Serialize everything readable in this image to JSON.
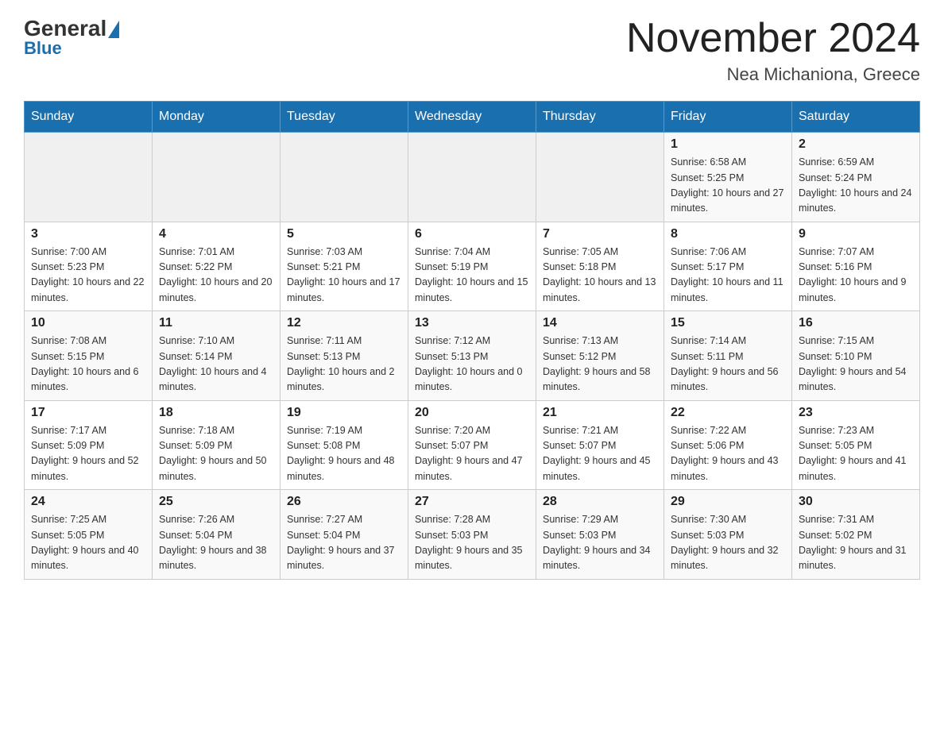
{
  "header": {
    "logo": {
      "general": "General",
      "blue": "Blue"
    },
    "title": "November 2024",
    "subtitle": "Nea Michaniona, Greece"
  },
  "weekdays": [
    "Sunday",
    "Monday",
    "Tuesday",
    "Wednesday",
    "Thursday",
    "Friday",
    "Saturday"
  ],
  "weeks": [
    {
      "days": [
        {
          "num": "",
          "info": ""
        },
        {
          "num": "",
          "info": ""
        },
        {
          "num": "",
          "info": ""
        },
        {
          "num": "",
          "info": ""
        },
        {
          "num": "",
          "info": ""
        },
        {
          "num": "1",
          "info": "Sunrise: 6:58 AM\nSunset: 5:25 PM\nDaylight: 10 hours and 27 minutes."
        },
        {
          "num": "2",
          "info": "Sunrise: 6:59 AM\nSunset: 5:24 PM\nDaylight: 10 hours and 24 minutes."
        }
      ]
    },
    {
      "days": [
        {
          "num": "3",
          "info": "Sunrise: 7:00 AM\nSunset: 5:23 PM\nDaylight: 10 hours and 22 minutes."
        },
        {
          "num": "4",
          "info": "Sunrise: 7:01 AM\nSunset: 5:22 PM\nDaylight: 10 hours and 20 minutes."
        },
        {
          "num": "5",
          "info": "Sunrise: 7:03 AM\nSunset: 5:21 PM\nDaylight: 10 hours and 17 minutes."
        },
        {
          "num": "6",
          "info": "Sunrise: 7:04 AM\nSunset: 5:19 PM\nDaylight: 10 hours and 15 minutes."
        },
        {
          "num": "7",
          "info": "Sunrise: 7:05 AM\nSunset: 5:18 PM\nDaylight: 10 hours and 13 minutes."
        },
        {
          "num": "8",
          "info": "Sunrise: 7:06 AM\nSunset: 5:17 PM\nDaylight: 10 hours and 11 minutes."
        },
        {
          "num": "9",
          "info": "Sunrise: 7:07 AM\nSunset: 5:16 PM\nDaylight: 10 hours and 9 minutes."
        }
      ]
    },
    {
      "days": [
        {
          "num": "10",
          "info": "Sunrise: 7:08 AM\nSunset: 5:15 PM\nDaylight: 10 hours and 6 minutes."
        },
        {
          "num": "11",
          "info": "Sunrise: 7:10 AM\nSunset: 5:14 PM\nDaylight: 10 hours and 4 minutes."
        },
        {
          "num": "12",
          "info": "Sunrise: 7:11 AM\nSunset: 5:13 PM\nDaylight: 10 hours and 2 minutes."
        },
        {
          "num": "13",
          "info": "Sunrise: 7:12 AM\nSunset: 5:13 PM\nDaylight: 10 hours and 0 minutes."
        },
        {
          "num": "14",
          "info": "Sunrise: 7:13 AM\nSunset: 5:12 PM\nDaylight: 9 hours and 58 minutes."
        },
        {
          "num": "15",
          "info": "Sunrise: 7:14 AM\nSunset: 5:11 PM\nDaylight: 9 hours and 56 minutes."
        },
        {
          "num": "16",
          "info": "Sunrise: 7:15 AM\nSunset: 5:10 PM\nDaylight: 9 hours and 54 minutes."
        }
      ]
    },
    {
      "days": [
        {
          "num": "17",
          "info": "Sunrise: 7:17 AM\nSunset: 5:09 PM\nDaylight: 9 hours and 52 minutes."
        },
        {
          "num": "18",
          "info": "Sunrise: 7:18 AM\nSunset: 5:09 PM\nDaylight: 9 hours and 50 minutes."
        },
        {
          "num": "19",
          "info": "Sunrise: 7:19 AM\nSunset: 5:08 PM\nDaylight: 9 hours and 48 minutes."
        },
        {
          "num": "20",
          "info": "Sunrise: 7:20 AM\nSunset: 5:07 PM\nDaylight: 9 hours and 47 minutes."
        },
        {
          "num": "21",
          "info": "Sunrise: 7:21 AM\nSunset: 5:07 PM\nDaylight: 9 hours and 45 minutes."
        },
        {
          "num": "22",
          "info": "Sunrise: 7:22 AM\nSunset: 5:06 PM\nDaylight: 9 hours and 43 minutes."
        },
        {
          "num": "23",
          "info": "Sunrise: 7:23 AM\nSunset: 5:05 PM\nDaylight: 9 hours and 41 minutes."
        }
      ]
    },
    {
      "days": [
        {
          "num": "24",
          "info": "Sunrise: 7:25 AM\nSunset: 5:05 PM\nDaylight: 9 hours and 40 minutes."
        },
        {
          "num": "25",
          "info": "Sunrise: 7:26 AM\nSunset: 5:04 PM\nDaylight: 9 hours and 38 minutes."
        },
        {
          "num": "26",
          "info": "Sunrise: 7:27 AM\nSunset: 5:04 PM\nDaylight: 9 hours and 37 minutes."
        },
        {
          "num": "27",
          "info": "Sunrise: 7:28 AM\nSunset: 5:03 PM\nDaylight: 9 hours and 35 minutes."
        },
        {
          "num": "28",
          "info": "Sunrise: 7:29 AM\nSunset: 5:03 PM\nDaylight: 9 hours and 34 minutes."
        },
        {
          "num": "29",
          "info": "Sunrise: 7:30 AM\nSunset: 5:03 PM\nDaylight: 9 hours and 32 minutes."
        },
        {
          "num": "30",
          "info": "Sunrise: 7:31 AM\nSunset: 5:02 PM\nDaylight: 9 hours and 31 minutes."
        }
      ]
    }
  ]
}
